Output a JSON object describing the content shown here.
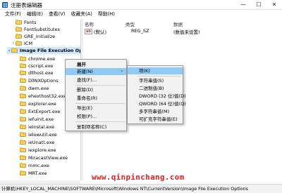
{
  "window": {
    "title": "注册表编辑器",
    "controls": [
      "—",
      "☐",
      "✕"
    ]
  },
  "menu": [
    "文件(F)",
    "编辑(E)",
    "查看(V)",
    "收藏夹(A)",
    "帮助(H)"
  ],
  "tree": [
    {
      "label": "Fonts",
      "chevron": ""
    },
    {
      "label": "FontSubstitutes",
      "chevron": ""
    },
    {
      "label": "GRE_Initialize",
      "chevron": ""
    },
    {
      "label": "ICM",
      "chevron": "›"
    },
    {
      "label": "Image File Execution Op",
      "chevron": "⌄"
    },
    {
      "label": "chrome.exe",
      "chevron": ""
    },
    {
      "label": "cscript.exe",
      "chevron": ""
    },
    {
      "label": "dllhost.exe",
      "chevron": ""
    },
    {
      "label": "DllNXOptions",
      "chevron": ""
    },
    {
      "label": "dwm.exe",
      "chevron": ""
    },
    {
      "label": "ehexthost32.exe",
      "chevron": ""
    },
    {
      "label": "explorer.exe",
      "chevron": ""
    },
    {
      "label": "ExtExport.exe",
      "chevron": ""
    },
    {
      "label": "iefuinit.exe",
      "chevron": ""
    },
    {
      "label": "ieinstal.exe",
      "chevron": ""
    },
    {
      "label": "ielowutil.exe",
      "chevron": ""
    },
    {
      "label": "ieUnatt.exe",
      "chevron": ""
    },
    {
      "label": "iexplore.exe",
      "chevron": ""
    },
    {
      "label": "MiracastView.exe",
      "chevron": ""
    },
    {
      "label": "mmc.exe",
      "chevron": ""
    },
    {
      "label": "MRT.exe",
      "chevron": ""
    }
  ],
  "values_pane": {
    "headers": {
      "name": "名称",
      "type": "类型",
      "data": "数据"
    },
    "row": {
      "name": "(默认)",
      "type": "REG_SZ",
      "data": "(数值未设置)"
    }
  },
  "context_menu": {
    "items": [
      "展开",
      "新建(N)",
      "查找(F)...",
      "删除(D)",
      "重命名(R)",
      "导出(E)",
      "权限(P)...",
      "复制项名称(C)"
    ]
  },
  "submenu": {
    "items": [
      "项(K)",
      "字符串值(S)",
      "二进制值(B)",
      "DWORD (32 位)值(D)",
      "QWORD (64 位)值(Q)",
      "多字符串值(M)",
      "可扩充字符串值(E)"
    ]
  },
  "statusbar": {
    "path": "计算机\\HKEY_LOCAL_MACHINE\\SOFTWARE\\Microsoft\\Windows NT\\CurrentVersion\\Image File Execution Options"
  },
  "watermark": "www.qinpinchang.com",
  "colors": {
    "highlight": "#91c9f7",
    "selected": "#cce8ff",
    "watermark": "#e02020"
  }
}
